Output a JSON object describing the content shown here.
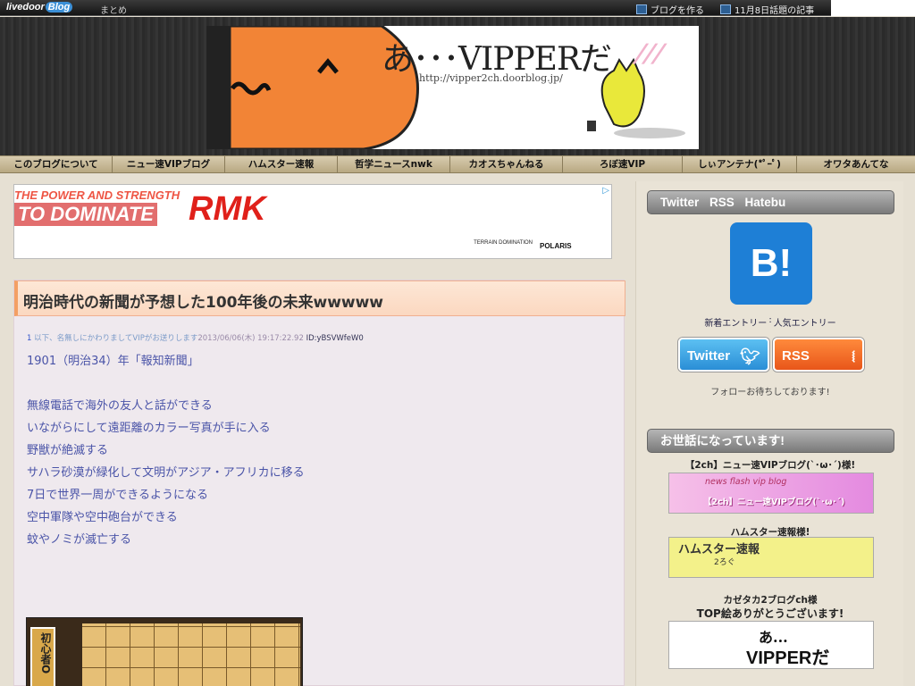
{
  "topbar": {
    "logo": "livedoor",
    "logo_blog": "Blog",
    "matome": "まとめ",
    "make_blog": "ブログを作る",
    "topic": "11月8日話題の記事"
  },
  "header": {
    "banner_title": "あ･･･VIPPERだ",
    "banner_url": "http://vipper2ch.doorblog.jp/",
    "banner_stripes": "///"
  },
  "nav": {
    "items": [
      "このブログについて",
      "ニュー速VIPブログ",
      "ハムスター速報",
      "哲学ニュースnwk",
      "カオスちゃんねる",
      "ろぼ速VIP",
      "しぃアンテナ(*ﾟｰﾟ)",
      "オワタあんてな"
    ]
  },
  "ad": {
    "tagline": "THE POWER AND STRENGTH",
    "dominate": "TO DOMINATE",
    "brand": "RMK",
    "terrain": "TERRAIN DOMINATION",
    "polaris": "POLARIS",
    "choice": "▷"
  },
  "article": {
    "title": "明治時代の新聞が予想した100年後の未来wwwww",
    "meta_num": "1",
    "meta_name": "以下、名無しにかわりましてVIPがお送りします",
    "meta_date": "2013/06/06(木) 19:17:22.92",
    "meta_id": "ID:yBSVWfeW0",
    "lines": [
      "1901（明治34）年「報知新聞」",
      "",
      "無線電話で海外の友人と話ができる",
      "いながらにして遠距離のカラー写真が手に入る",
      "野獣が絶滅する",
      "サハラ砂漠が緑化して文明がアジア・アフリカに移る",
      "7日で世界一周ができるようになる",
      "空中軍隊や空中砲台ができる",
      "蚊やノミが滅亡する"
    ],
    "shogi_label": "初心者O"
  },
  "sidebar": {
    "section1_title": "Twitter RSS Hatebu",
    "hatebu_icon_text": "B!",
    "hatebu_links": [
      "新着エントリー",
      ":",
      "人気エントリー"
    ],
    "twitter_btn": "Twitter",
    "rss_btn": "RSS",
    "follow_text": "フォローお待ちしております!",
    "section2_title": "お世話になっています!",
    "link1_label": "【2ch】ニュー速VIPブログ(`･ω･´)様!",
    "link1_banner_top": "news flash vip blog",
    "link1_banner_main": "【2ch】ニュー速VIPブログ(`･ω･´)",
    "link2_label": "ハムスター速報様!",
    "link2_banner_main": "ハムスター速報",
    "link2_banner_sub": "2ろぐ",
    "link3_label_1": "カゼタカ2ブログch様",
    "link3_label_2": "TOP絵ありがとうございます!",
    "link3_banner_top": "あ...",
    "link3_banner_main": "VIPPERだ"
  },
  "colors": {
    "accent_title_bar": "#fbd8c0",
    "post_text": "#4a54a8",
    "twitter": "#2a8ed6",
    "rss": "#e8561a",
    "hatebu": "#1e7fd6"
  }
}
